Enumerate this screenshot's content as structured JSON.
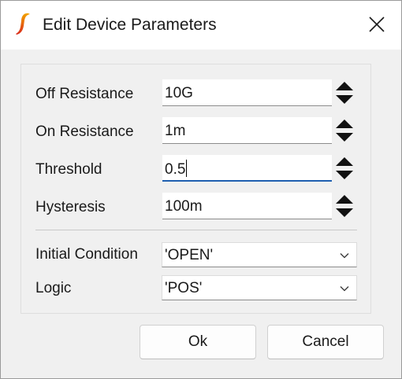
{
  "window": {
    "title": "Edit Device Parameters",
    "icon": "ltspice-logo-icon",
    "close_icon": "close-icon"
  },
  "fields": [
    {
      "label": "Off Resistance",
      "value": "10G"
    },
    {
      "label": "On Resistance",
      "value": "1m"
    },
    {
      "label": "Threshold",
      "value": "0.5"
    },
    {
      "label": "Hysteresis",
      "value": "100m"
    }
  ],
  "selects": [
    {
      "label": "Initial Condition",
      "value": "'OPEN'"
    },
    {
      "label": "Logic",
      "value": "'POS'"
    }
  ],
  "buttons": {
    "ok": "Ok",
    "cancel": "Cancel"
  },
  "colors": {
    "focus_accent": "#1f5fb0",
    "logo_gradient_top": "#f2a400",
    "logo_gradient_bottom": "#d9281c"
  }
}
